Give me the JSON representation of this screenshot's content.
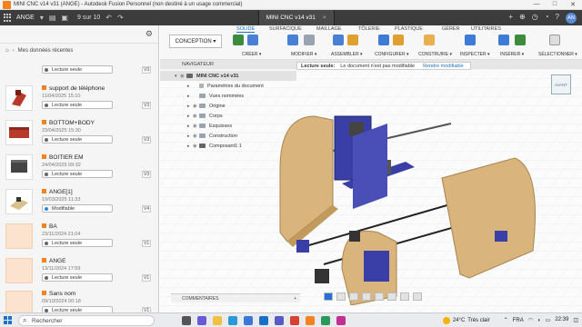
{
  "window": {
    "title": "MINI CNC v14 v31 (ANGE) - Autodesk Fusion Personnel (non destiné à un usage commercial)",
    "controls": [
      "—",
      "□",
      "✕"
    ]
  },
  "header": {
    "project": "ANGE",
    "pager": "9 sur 10",
    "doc_tab": "MINI CNC v14 v31",
    "doc_tab_close": "×",
    "user_initials": "AN"
  },
  "data_panel": {
    "breadcrumb_home": "⌂",
    "breadcrumb_label": "Mes données récentes",
    "items": [
      {
        "name": "",
        "date": "",
        "status": "Lecture seule",
        "version": "V3"
      },
      {
        "name": "support de téléphone",
        "date": "11/04/2025 15:10",
        "status": "Lecture seule",
        "version": "V3"
      },
      {
        "name": "BOTTOM+BODY",
        "date": "23/04/2025 15:30",
        "status": "Lecture seule",
        "version": "V3"
      },
      {
        "name": "BOITIER EM",
        "date": "24/04/2025 09:32",
        "status": "Lecture seule",
        "version": "V3"
      },
      {
        "name": "ANGE[1]",
        "date": "19/03/2025 11:33",
        "status": "Modifiable",
        "version": "V4"
      },
      {
        "name": "BA",
        "date": "23/11/2024 21:04",
        "status": "Lecture seule",
        "version": "V1"
      },
      {
        "name": "ANGE",
        "date": "13/11/2024 17:59",
        "status": "Lecture seule",
        "version": "V1"
      },
      {
        "name": "Sans nom",
        "date": "09/10/2024 00:18",
        "status": "Lecture seule",
        "version": "V1"
      }
    ]
  },
  "toolbar": {
    "workspace": "CONCEPTION ▾",
    "tabs": [
      "SOLIDE",
      "SURFACIQUE",
      "MAILLAGE",
      "TÔLERIE",
      "PLASTIQUE",
      "GÉRER",
      "UTILITAIRES"
    ],
    "groups": [
      "CRÉER ▾",
      "MODIFIER ▾",
      "ASSEMBLER ▾",
      "CONFIGURER ▾",
      "CONSTRUIRE ▾",
      "INSPECTER ▾",
      "INSÉRER ▾",
      "SÉLECTIONNER ▾"
    ],
    "accent_color": "#1a73c7"
  },
  "viewport": {
    "navigator_label": "NAVIGATEUR",
    "readonly_label": "Lecture seule:",
    "readonly_msg": "Le document n'est pas modifiable",
    "edit_button": "Rendre modifiable",
    "viewcube_label": "AVANT",
    "browser": {
      "root": "MINI CNC v14 v31",
      "rows": [
        "Paramètres du document",
        "Vues nommées",
        "Origine",
        "Corps",
        "Esquisses",
        "Construction",
        "Composant1:1"
      ]
    },
    "comments_label": "COMMENTAIRES",
    "comments_plus": "+"
  },
  "taskbar": {
    "search_label": "Rechercher",
    "weather_temp": "24°C",
    "weather_text": "Très clair",
    "lang": "FRA",
    "time": "22:39",
    "date": ""
  }
}
